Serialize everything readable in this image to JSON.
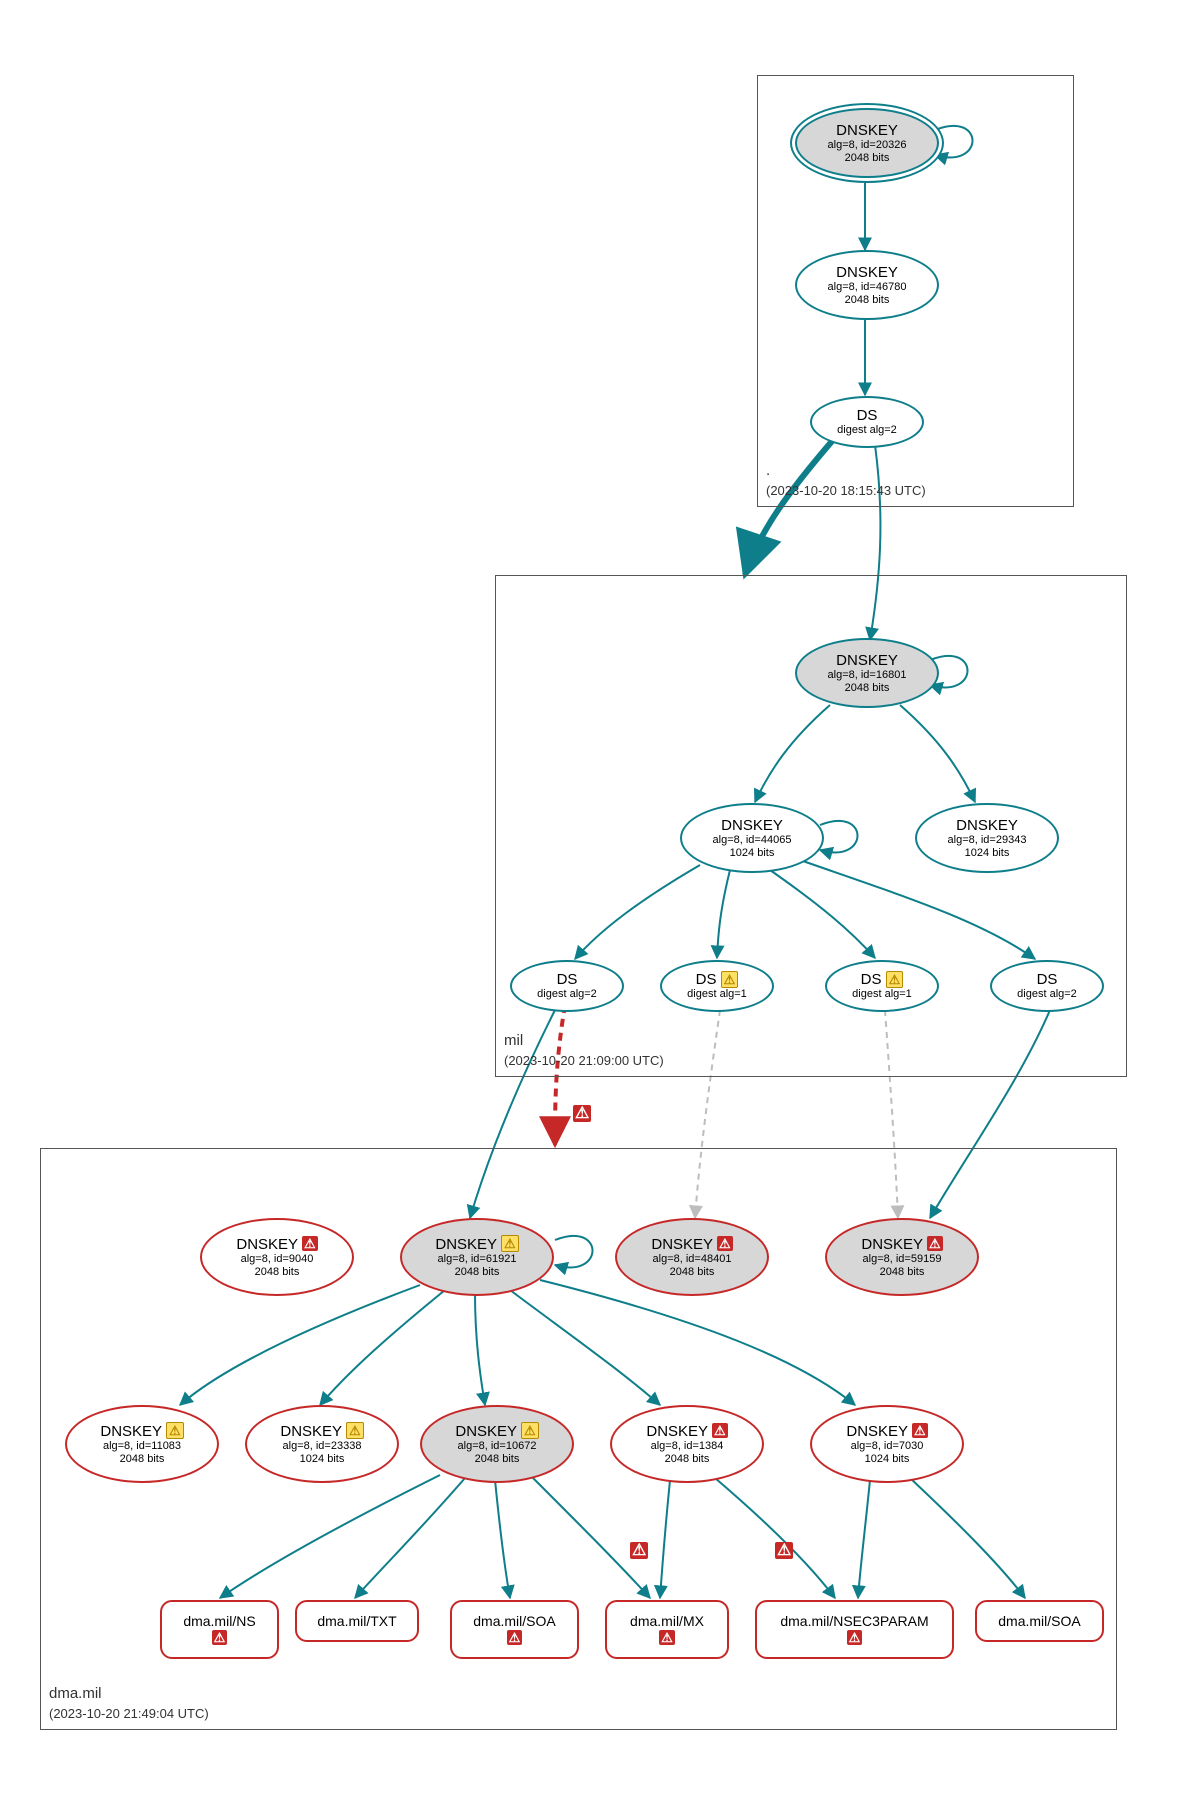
{
  "zones": {
    "root": {
      "name": ".",
      "ts": "(2023-10-20 18:15:43 UTC)"
    },
    "mil": {
      "name": "mil",
      "ts": "(2023-10-20 21:09:00 UTC)"
    },
    "dma": {
      "name": "dma.mil",
      "ts": "(2023-10-20 21:49:04 UTC)"
    }
  },
  "root": {
    "dnskey1": {
      "title": "DNSKEY",
      "l1": "alg=8, id=20326",
      "l2": "2048 bits"
    },
    "dnskey2": {
      "title": "DNSKEY",
      "l1": "alg=8, id=46780",
      "l2": "2048 bits"
    },
    "ds": {
      "title": "DS",
      "l1": "digest alg=2"
    }
  },
  "mil": {
    "dnskey1": {
      "title": "DNSKEY",
      "l1": "alg=8, id=16801",
      "l2": "2048 bits"
    },
    "dnskey2": {
      "title": "DNSKEY",
      "l1": "alg=8, id=44065",
      "l2": "1024 bits"
    },
    "dnskey3": {
      "title": "DNSKEY",
      "l1": "alg=8, id=29343",
      "l2": "1024 bits"
    },
    "ds1": {
      "title": "DS",
      "l1": "digest alg=2"
    },
    "ds2": {
      "title": "DS",
      "l1": "digest alg=1"
    },
    "ds3": {
      "title": "DS",
      "l1": "digest alg=1"
    },
    "ds4": {
      "title": "DS",
      "l1": "digest alg=2"
    }
  },
  "dma": {
    "k9040": {
      "title": "DNSKEY",
      "l1": "alg=8, id=9040",
      "l2": "2048 bits"
    },
    "k61921": {
      "title": "DNSKEY",
      "l1": "alg=8, id=61921",
      "l2": "2048 bits"
    },
    "k48401": {
      "title": "DNSKEY",
      "l1": "alg=8, id=48401",
      "l2": "2048 bits"
    },
    "k59159": {
      "title": "DNSKEY",
      "l1": "alg=8, id=59159",
      "l2": "2048 bits"
    },
    "k11083": {
      "title": "DNSKEY",
      "l1": "alg=8, id=11083",
      "l2": "2048 bits"
    },
    "k23338": {
      "title": "DNSKEY",
      "l1": "alg=8, id=23338",
      "l2": "1024 bits"
    },
    "k10672": {
      "title": "DNSKEY",
      "l1": "alg=8, id=10672",
      "l2": "2048 bits"
    },
    "k1384": {
      "title": "DNSKEY",
      "l1": "alg=8, id=1384",
      "l2": "2048 bits"
    },
    "k7030": {
      "title": "DNSKEY",
      "l1": "alg=8, id=7030",
      "l2": "1024 bits"
    }
  },
  "rr": {
    "ns": "dma.mil/NS",
    "txt": "dma.mil/TXT",
    "soa": "dma.mil/SOA",
    "mx": "dma.mil/MX",
    "nsec3": "dma.mil/NSEC3PARAM",
    "soa2": "dma.mil/SOA"
  },
  "colors": {
    "teal": "#0d7e8a",
    "red": "#c62828",
    "gray": "#bdbdbd"
  }
}
